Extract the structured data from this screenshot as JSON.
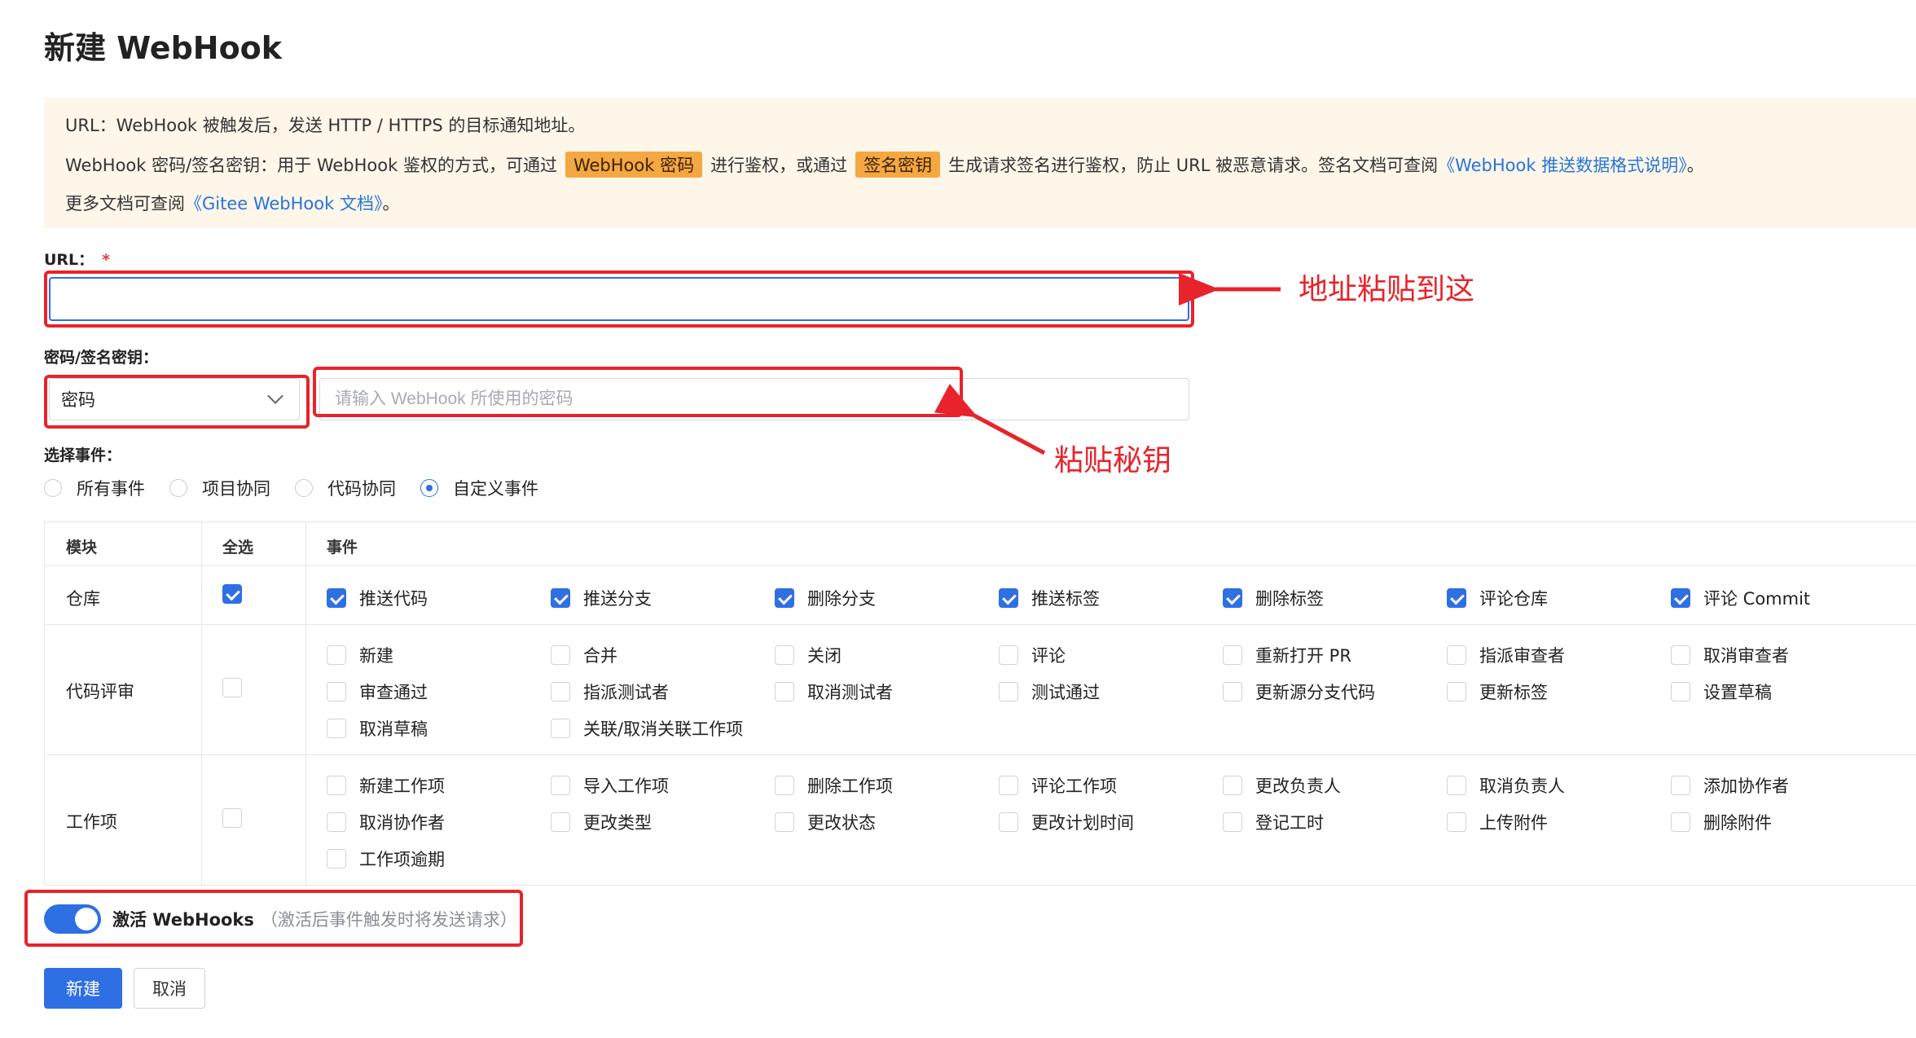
{
  "page": {
    "title": "新建 WebHook"
  },
  "notice": {
    "line1": "URL：WebHook 被触发后，发送 HTTP / HTTPS 的目标通知地址。",
    "line2_prefix": "WebHook 密码/签名密钥：用于 WebHook 鉴权的方式，可通过",
    "tag_password": "WebHook 密码",
    "line2_mid1": "进行鉴权，或通过",
    "tag_signature": "签名密钥",
    "line2_mid2": "生成请求签名进行鉴权，防止 URL 被恶意请求。签名文档可查阅",
    "link_push_format": "《WebHook 推送数据格式说明》",
    "line2_suffix": "。",
    "line3_prefix": "更多文档可查阅",
    "link_docs": "《Gitee WebHook 文档》",
    "line3_suffix": "。"
  },
  "url_field": {
    "label": "URL：",
    "required_mark": "*",
    "value": ""
  },
  "secret": {
    "label": "密码/签名密钥：",
    "type_selected": "密码",
    "placeholder": "请输入 WebHook 所使用的密码",
    "value": ""
  },
  "events_section": {
    "label": "选择事件：",
    "options": [
      "所有事件",
      "项目协同",
      "代码协同",
      "自定义事件"
    ],
    "selected_index": 3
  },
  "events_table": {
    "headers": {
      "module": "模块",
      "select_all": "全选",
      "events": "事件"
    },
    "modules": [
      {
        "name": "仓库",
        "all_checked": true,
        "items": [
          {
            "label": "推送代码",
            "checked": true
          },
          {
            "label": "推送分支",
            "checked": true
          },
          {
            "label": "删除分支",
            "checked": true
          },
          {
            "label": "推送标签",
            "checked": true
          },
          {
            "label": "删除标签",
            "checked": true
          },
          {
            "label": "评论仓库",
            "checked": true
          },
          {
            "label": "评论 Commit",
            "checked": true
          }
        ]
      },
      {
        "name": "代码评审",
        "all_checked": false,
        "items": [
          {
            "label": "新建",
            "checked": false
          },
          {
            "label": "合并",
            "checked": false
          },
          {
            "label": "关闭",
            "checked": false
          },
          {
            "label": "评论",
            "checked": false
          },
          {
            "label": "重新打开 PR",
            "checked": false
          },
          {
            "label": "指派审查者",
            "checked": false
          },
          {
            "label": "取消审查者",
            "checked": false
          },
          {
            "label": "审查通过",
            "checked": false
          },
          {
            "label": "指派测试者",
            "checked": false
          },
          {
            "label": "取消测试者",
            "checked": false
          },
          {
            "label": "测试通过",
            "checked": false
          },
          {
            "label": "更新源分支代码",
            "checked": false
          },
          {
            "label": "更新标签",
            "checked": false
          },
          {
            "label": "设置草稿",
            "checked": false
          },
          {
            "label": "取消草稿",
            "checked": false
          },
          {
            "label": "关联/取消关联工作项",
            "checked": false
          }
        ]
      },
      {
        "name": "工作项",
        "all_checked": false,
        "items": [
          {
            "label": "新建工作项",
            "checked": false
          },
          {
            "label": "导入工作项",
            "checked": false
          },
          {
            "label": "删除工作项",
            "checked": false
          },
          {
            "label": "评论工作项",
            "checked": false
          },
          {
            "label": "更改负责人",
            "checked": false
          },
          {
            "label": "取消负责人",
            "checked": false
          },
          {
            "label": "添加协作者",
            "checked": false
          },
          {
            "label": "取消协作者",
            "checked": false
          },
          {
            "label": "更改类型",
            "checked": false
          },
          {
            "label": "更改状态",
            "checked": false
          },
          {
            "label": "更改计划时间",
            "checked": false
          },
          {
            "label": "登记工时",
            "checked": false
          },
          {
            "label": "上传附件",
            "checked": false
          },
          {
            "label": "删除附件",
            "checked": false
          },
          {
            "label": "工作项逾期",
            "checked": false
          }
        ]
      }
    ]
  },
  "activate": {
    "label": "激活 WebHooks",
    "hint": "（激活后事件触发时将发送请求）",
    "enabled": true
  },
  "buttons": {
    "create": "新建",
    "cancel": "取消"
  },
  "annotations": {
    "paste_url": "地址粘贴到这",
    "paste_secret": "粘贴秘钥"
  },
  "colors": {
    "primary": "#2f6fe4",
    "notice_bg": "#fdf6e9",
    "tag_bg": "#f5a742",
    "annotation": "#e8232b"
  }
}
